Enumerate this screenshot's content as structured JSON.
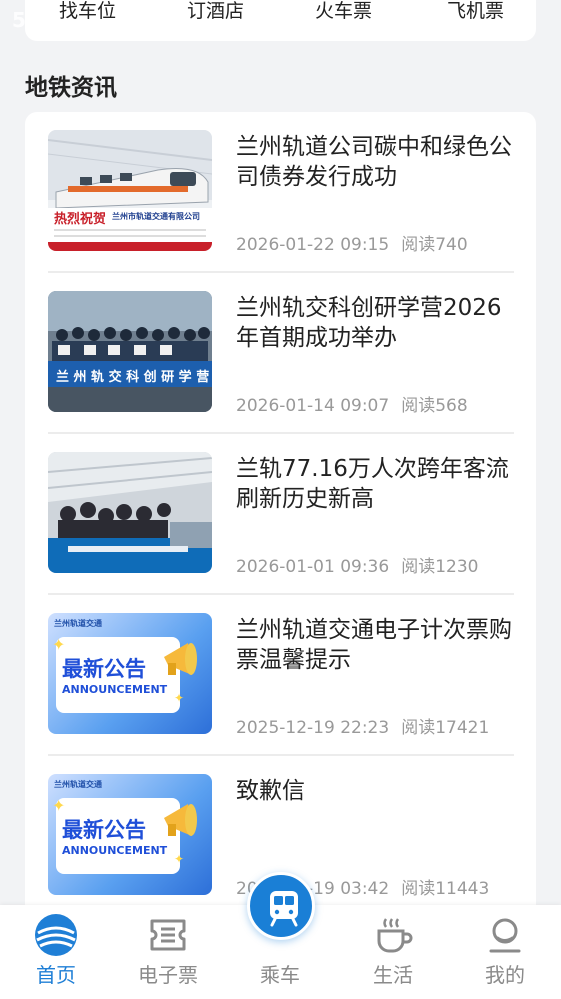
{
  "status": {
    "partial_text": "5"
  },
  "quick_links": [
    "找车位",
    "订酒店",
    "火车票",
    "飞机票"
  ],
  "section_title": "地铁资讯",
  "news": [
    {
      "title": "兰州轨道公司碳中和绿色公司债券发行成功",
      "date": "2026-01-22 09:15",
      "reads": "阅读740",
      "thumb_icon": "train-celebration-image"
    },
    {
      "title": "兰州轨交科创研学营2026年首期成功举办",
      "date": "2026-01-14 09:07",
      "reads": "阅读568",
      "thumb_icon": "study-camp-group-photo"
    },
    {
      "title": "兰轨77.16万人次跨年客流刷新历史新高",
      "date": "2026-01-01 09:36",
      "reads": "阅读1230",
      "thumb_icon": "station-crowd-photo"
    },
    {
      "title": "兰州轨道交通电子计次票购票温馨提示",
      "date": "2025-12-19 22:23",
      "reads": "阅读17421",
      "thumb_icon": "announcement-image"
    },
    {
      "title": "致歉信",
      "date": "2025-12-19 03:42",
      "reads": "阅读11443",
      "thumb_icon": "announcement-image"
    }
  ],
  "thumb_text": {
    "congrats": "热烈祝贺",
    "company": "兰州市轨道交通有限公司",
    "banner": "兰 州 轨 交 科 创 研 学 营",
    "announce_cn": "最新公告",
    "announce_en": "ANNOUNCEMENT",
    "announce_logo": "兰州轨道交通"
  },
  "tabs": [
    {
      "label": "首页",
      "icon": "home-logo-icon",
      "active": true
    },
    {
      "label": "电子票",
      "icon": "ticket-icon",
      "active": false
    },
    {
      "label": "乘车",
      "icon": "metro-icon",
      "active": false
    },
    {
      "label": "生活",
      "icon": "coffee-cup-icon",
      "active": false
    },
    {
      "label": "我的",
      "icon": "user-icon",
      "active": false
    }
  ],
  "colors": {
    "accent": "#1f7fd6",
    "background": "#f2f3f5",
    "card": "#ffffff",
    "meta_text": "#999999"
  }
}
